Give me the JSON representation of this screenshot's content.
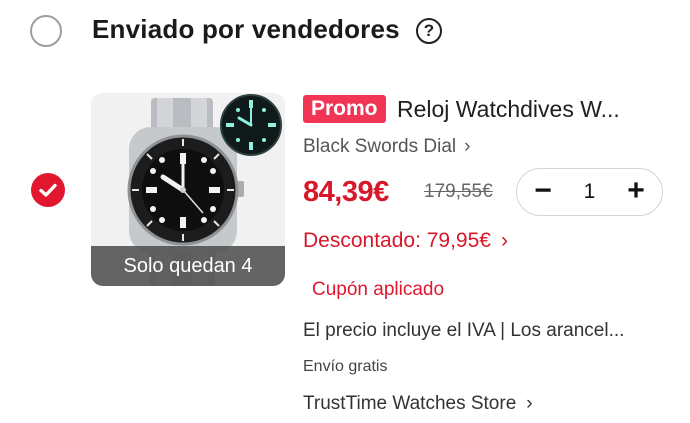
{
  "section": {
    "title": "Enviado por vendedores",
    "help_icon": "?"
  },
  "item": {
    "selected": true,
    "thumbnail": {
      "stock_banner": "Solo quedan 4",
      "image_subject": "watch-image"
    },
    "promo_badge": "Promo",
    "title": "Reloj Watchdives W...",
    "variant": "Black Swords Dial",
    "price": "84,39€",
    "original_price": "179,55€",
    "quantity": "1",
    "minus_symbol": "−",
    "plus_symbol": "+",
    "discount": "Descontado: 79,95€",
    "coupon": "Cupón aplicado",
    "tax_note": "El precio incluye el IVA | Los arancel...",
    "shipping": "Envío gratis",
    "store": "TrustTime Watches Store",
    "chevron": "›"
  },
  "colors": {
    "accent_red": "#d7182a",
    "promo_pink": "#f23554",
    "check_red": "#e0172e"
  }
}
